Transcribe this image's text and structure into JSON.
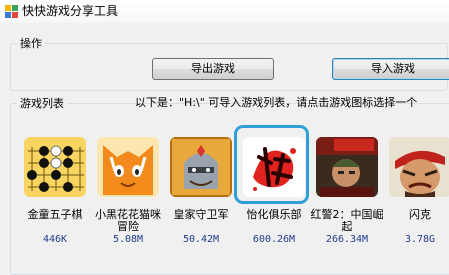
{
  "window": {
    "title": "快快游戏分享工具",
    "icon": "app-icon-colored-squares"
  },
  "operations": {
    "group_title": "操作",
    "export_button": "导出游戏",
    "import_button": "导入游戏"
  },
  "game_list": {
    "group_title": "游戏列表",
    "hint": "以下是：\"H:\\\"  可导入游戏列表，请点击游戏图标选择一个",
    "games": [
      {
        "name": "金童五子棋",
        "size": "446K",
        "icon": "gomoku-board-icon"
      },
      {
        "name": "小黑花花猫咪冒险",
        "size": "5.08M",
        "icon": "orange-cat-icon"
      },
      {
        "name": "皇家守卫军",
        "size": "50.42M",
        "icon": "royal-guard-knight-icon"
      },
      {
        "name": "怡化俱乐部",
        "size": "600.26M",
        "icon": "red-calligraphy-icon",
        "selected": true
      },
      {
        "name": "红警2：中国崛起",
        "size": "266.34M",
        "icon": "red-alert-soldier-icon"
      },
      {
        "name": "闪克",
        "size": "3.78G",
        "icon": "shank-fighter-icon"
      }
    ]
  },
  "colors": {
    "selection_border": "#2f9fd6",
    "size_text": "#1f3c8a",
    "window_bg": "#f0f0f0"
  }
}
